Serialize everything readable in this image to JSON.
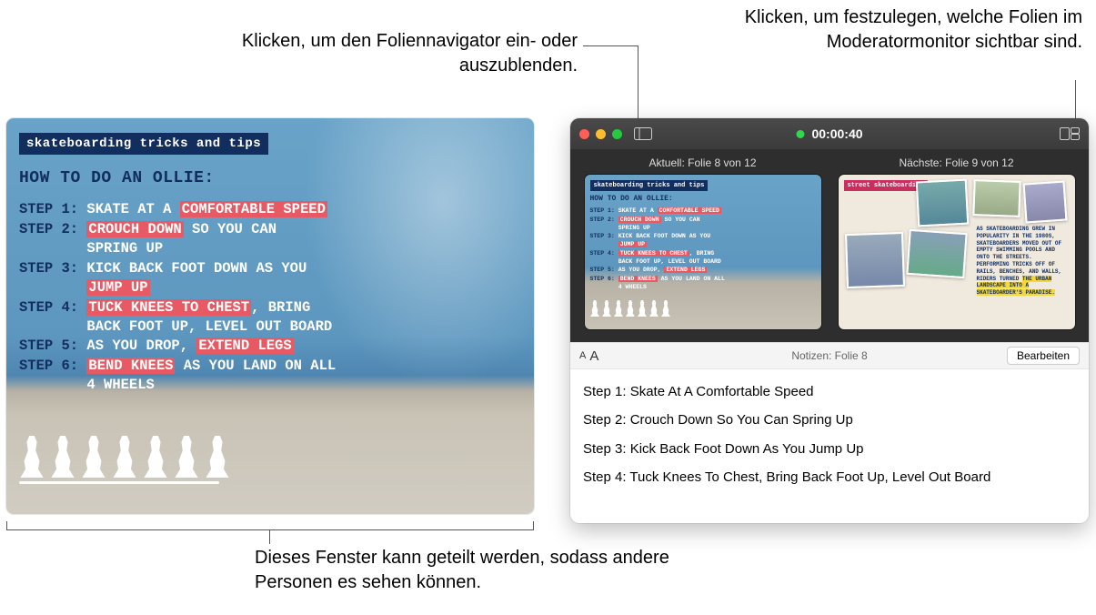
{
  "callouts": {
    "navigator": "Klicken, um den Foliennavigator ein- oder auszublenden.",
    "layout": "Klicken, um festzulegen, welche Folien im Moderatormonitor sichtbar sind.",
    "share": "Dieses Fenster kann geteilt werden, sodass andere Personen es sehen können."
  },
  "main_slide": {
    "badge": "skateboarding tricks and tips",
    "title": "HOW TO DO AN OLLIE:",
    "steps": [
      {
        "label": "STEP 1:",
        "pre": "SKATE AT A ",
        "hl": "COMFORTABLE SPEED",
        "post": ""
      },
      {
        "label": "STEP 2:",
        "pre": "",
        "hl": "CROUCH DOWN",
        "post": " SO YOU CAN\nSPRING UP"
      },
      {
        "label": "STEP 3:",
        "pre": "KICK BACK FOOT DOWN AS YOU\n",
        "hl": "JUMP UP",
        "post": ""
      },
      {
        "label": "STEP 4:",
        "pre": "",
        "hl": "TUCK KNEES TO CHEST",
        "post": ", BRING\nBACK FOOT UP, LEVEL OUT BOARD"
      },
      {
        "label": "STEP 5:",
        "pre": "AS YOU DROP, ",
        "hl": "EXTEND LEGS",
        "post": ""
      },
      {
        "label": "STEP 6:",
        "pre": "",
        "hl": "BEND KNEES",
        "post": " AS YOU LAND ON ALL\n4 WHEELS"
      }
    ]
  },
  "presenter": {
    "timer": "00:00:40",
    "current_label": "Aktuell: Folie 8 von 12",
    "next_label": "Nächste: Folie 9 von 12",
    "next_thumb": {
      "badge": "street skateboarding",
      "text_pre": "AS SKATEBOARDING GREW IN POPULARITY IN THE 1980S, SKATEBOARDERS MOVED OUT OF EMPTY SWIMMING POOLS AND ONTO THE STREETS. PERFORMING TRICKS OFF OF RAILS, BENCHES, AND WALLS, RIDERS TURNED ",
      "text_hl": "THE URBAN LANDSCAPE INTO A SKATEBOARDER'S PARADISE."
    },
    "notes_bar_title": "Notizen: Folie 8",
    "edit_button": "Bearbeiten",
    "notes": [
      "Step 1: Skate At A Comfortable Speed",
      "Step 2: Crouch Down So You Can Spring Up",
      "Step 3: Kick Back Foot Down As You Jump Up",
      "Step 4: Tuck Knees To Chest, Bring Back Foot Up, Level Out Board"
    ]
  }
}
